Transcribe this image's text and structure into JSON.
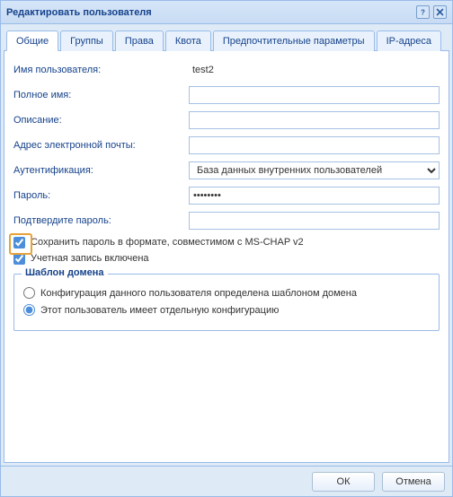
{
  "title": "Редактировать пользователя",
  "tabs": [
    "Общие",
    "Группы",
    "Права",
    "Квота",
    "Предпочтительные параметры",
    "IP-адреса"
  ],
  "activeTab": 0,
  "fields": {
    "username": {
      "label": "Имя пользователя:",
      "value": "test2"
    },
    "fullname": {
      "label": "Полное имя:",
      "value": ""
    },
    "description": {
      "label": "Описание:",
      "value": ""
    },
    "email": {
      "label": "Адрес электронной почты:",
      "value": ""
    },
    "auth": {
      "label": "Аутентификация:",
      "value": "База данных внутренних пользователей",
      "options": [
        "База данных внутренних пользователей"
      ]
    },
    "password": {
      "label": "Пароль:",
      "value": "********"
    },
    "confirm": {
      "label": "Подтвердите пароль:",
      "value": ""
    }
  },
  "checkboxes": {
    "mschap": {
      "label": "Сохранить пароль в формате, совместимом с MS-CHAP v2",
      "checked": true
    },
    "accountEnabled": {
      "label": "Учетная запись включена",
      "checked": true
    }
  },
  "templateGroup": {
    "legend": "Шаблон домена",
    "radios": {
      "domain": {
        "label": "Конфигурация данного пользователя определена шаблоном домена",
        "selected": false
      },
      "separate": {
        "label": "Этот пользователь имеет отдельную конфигурацию",
        "selected": true
      }
    }
  },
  "buttons": {
    "ok": "ОК",
    "cancel": "Отмена"
  }
}
